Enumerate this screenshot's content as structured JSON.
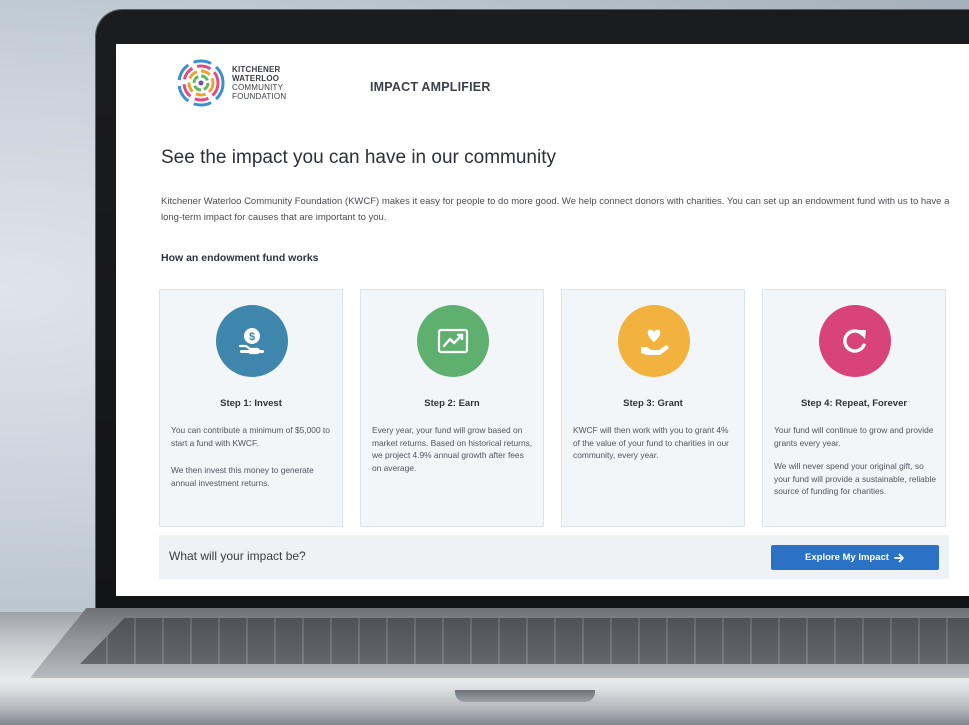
{
  "header": {
    "logo_line1": "KITCHENER",
    "logo_line2": "WATERLOO",
    "logo_line3": "COMMUNITY",
    "logo_line4": "FOUNDATION",
    "app_title": "IMPACT AMPLIFIER"
  },
  "main": {
    "headline": "See the impact you can have in our community",
    "intro": "Kitchener Waterloo Community Foundation (KWCF) makes it easy for people to do more good. We help connect donors with charities. You can set up an endowment fund with us to have a long-term impact for causes that are important to you.",
    "section_label": "How an endowment fund works"
  },
  "steps": [
    {
      "title": "Step 1: Invest",
      "p1": "You can contribute a minimum of $5,000 to start a fund with KWCF.",
      "p2": "We then invest this money to generate annual investment returns.",
      "icon": "money-hand-icon",
      "color": "#3f86ad"
    },
    {
      "title": "Step 2: Earn",
      "p1": "Every year, your fund will grow based on market returns. Based on historical returns, we project 4.9% annual growth after fees on average.",
      "icon": "growth-chart-icon",
      "color": "#5fb06f"
    },
    {
      "title": "Step 3: Grant",
      "p1": "KWCF will then work with you to grant 4% of the value of your fund to charities in our community, every year.",
      "icon": "heart-hand-icon",
      "color": "#f2b23e"
    },
    {
      "title": "Step 4: Repeat, Forever",
      "p1": "Your fund will continue to grow and provide grants every year.",
      "p2": "We will never spend your original gift, so your fund will provide a sustainable, reliable source of funding for charities.",
      "icon": "repeat-icon",
      "color": "#d8437a"
    }
  ],
  "footer": {
    "question": "What will your impact be?",
    "cta_label": "Explore My Impact"
  }
}
